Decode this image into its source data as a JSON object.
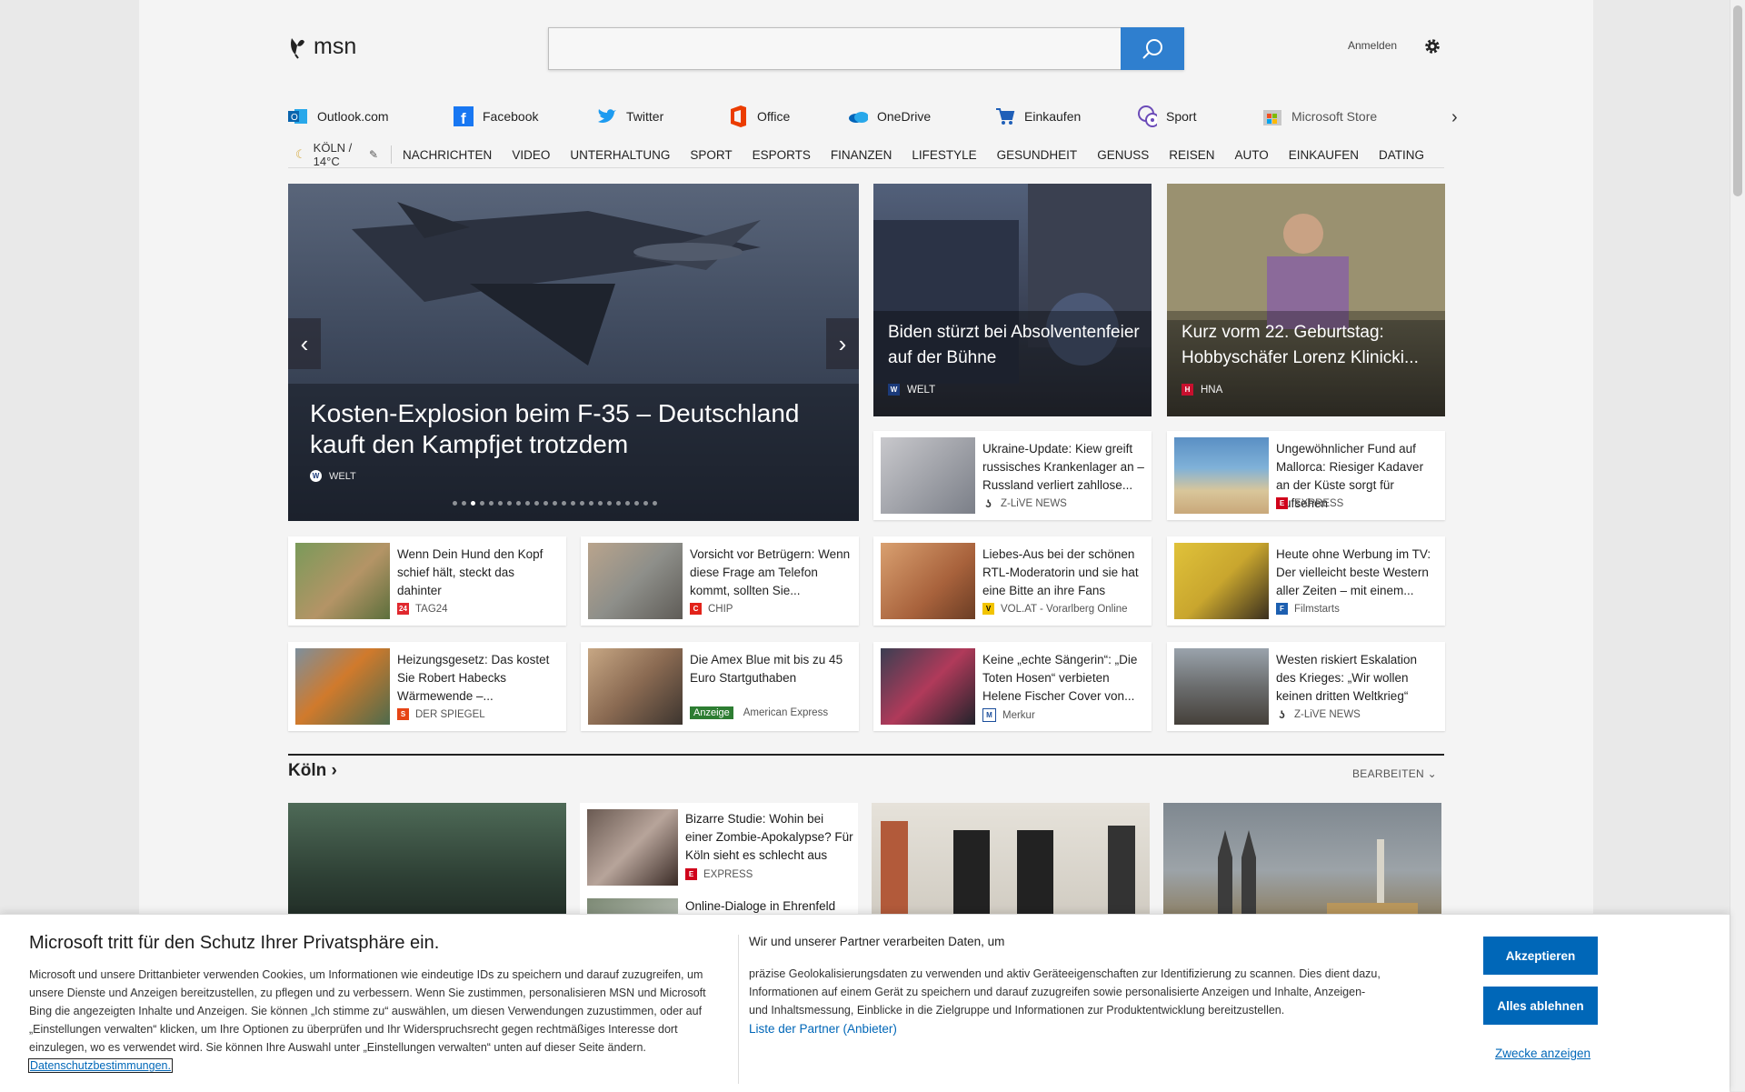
{
  "header": {
    "logo_text": "msn",
    "search_placeholder": "",
    "signin_label": "Anmelden"
  },
  "quick_links": [
    {
      "label": "Outlook.com",
      "icon": "outlook-icon"
    },
    {
      "label": "Facebook",
      "icon": "facebook-icon"
    },
    {
      "label": "Twitter",
      "icon": "twitter-icon"
    },
    {
      "label": "Office",
      "icon": "office-icon"
    },
    {
      "label": "OneDrive",
      "icon": "onedrive-icon"
    },
    {
      "label": "Einkaufen",
      "icon": "cart-icon"
    },
    {
      "label": "Sport",
      "icon": "sport-icon"
    },
    {
      "label": "Microsoft Store",
      "icon": "store-icon"
    }
  ],
  "weather": {
    "text": "KÖLN / 14°C"
  },
  "categories": [
    "NACHRICHTEN",
    "VIDEO",
    "UNTERHALTUNG",
    "SPORT",
    "ESPORTS",
    "FINANZEN",
    "LIFESTYLE",
    "GESUNDHEIT",
    "GENUSS",
    "REISEN",
    "AUTO",
    "EINKAUFEN",
    "DATING"
  ],
  "hero": {
    "title": "Kosten-Explosion beim F-35 – Deutschland kauft den Kampfjet trotzdem",
    "source": "WELT",
    "dot_count": 23,
    "active_dot": 3
  },
  "big_tiles": [
    {
      "title": "Biden stürzt bei Absolventenfeier auf der Bühne",
      "source": "WELT"
    },
    {
      "title": "Kurz vorm 22. Geburtstag: Hobbyschäfer Lorenz Klinicki...",
      "source": "HNA"
    }
  ],
  "cards": [
    {
      "title": "Ukraine-Update: Kiew greift russisches Krankenlager an – Russland verliert zahllose...",
      "source": "Z-LiVE NEWS"
    },
    {
      "title": "Ungewöhnlicher Fund auf Mallorca: Riesiger Kadaver an der Küste sorgt für Aufsehen",
      "source": "EXPRESS"
    },
    {
      "title": "Wenn Dein Hund den Kopf schief hält, steckt das dahinter",
      "source": "TAG24"
    },
    {
      "title": "Vorsicht vor Betrügern: Wenn diese Frage am Telefon kommt, sollten Sie...",
      "source": "CHIP"
    },
    {
      "title": "Liebes-Aus bei der schönen RTL-Moderatorin und sie hat eine Bitte an ihre Fans",
      "source": "VOL.AT - Vorarlberg Online"
    },
    {
      "title": "Heute ohne Werbung im TV: Der vielleicht beste Western aller Zeiten – mit einem...",
      "source": "Filmstarts"
    },
    {
      "title": "Heizungsgesetz: Das kostet Sie Robert Habecks Wärmewende –...",
      "source": "DER SPIEGEL"
    },
    {
      "title": "Die Amex Blue mit bis zu 45 Euro Startguthaben",
      "source": "American Express",
      "badge": "Anzeige"
    },
    {
      "title": "Keine „echte Sängerin“: „Die Toten Hosen“ verbieten Helene Fischer Cover von...",
      "source": "Merkur"
    },
    {
      "title": "Westen riskiert Eskalation des Krieges: „Wir wollen keinen dritten Weltkrieg“",
      "source": "Z-LiVE NEWS"
    }
  ],
  "koeln": {
    "title": "Köln",
    "edit_label": "BEARBEITEN",
    "items": [
      {
        "title": "Bizarre Studie: Wohin bei einer Zombie-Apokalypse? Für Köln sieht es schlecht aus",
        "source": "EXPRESS"
      },
      {
        "title": "Online-Dialoge in Ehrenfeld"
      }
    ]
  },
  "consent": {
    "title": "Microsoft tritt für den Schutz Ihrer Privatsphäre ein.",
    "body": "Microsoft und unsere Drittanbieter verwenden Cookies, um Informationen wie eindeutige IDs zu speichern und darauf zuzugreifen, um unsere Dienste und Anzeigen bereitzustellen, zu pflegen und zu verbessern. Wenn Sie zustimmen, personalisieren MSN und Microsoft Bing die angezeigten Inhalte und Anzeigen. Sie können „Ich stimme zu“ auswählen, um diesen Verwendungen zuzustimmen, oder auf „Einstellungen verwalten“ klicken, um Ihre Optionen zu überprüfen und Ihr Widerspruchsrecht gegen rechtmäßiges Interesse dort einzulegen, wo es verwendet wird.  Sie können Ihre Auswahl unter „Einstellungen verwalten“ unten auf dieser Seite ändern.",
    "privacy_link": "Datenschutzbestimmungen.",
    "partner_heading": "Wir und unserer Partner verarbeiten Daten, um",
    "partner_body": "präzise Geolokalisierungsdaten zu verwenden und aktiv Geräteeigenschaften zur Identifizierung zu scannen. Dies dient dazu, Informationen auf einem Gerät zu speichern und darauf zuzugreifen sowie personalisierte Anzeigen und Inhalte, Anzeigen- und Inhaltsmessung, Einblicke in die Zielgruppe und Informationen zur Produktentwicklung bereitzustellen.",
    "partner_list": "Liste der Partner (Anbieter)",
    "accept_label": "Akzeptieren",
    "reject_label": "Alles ablehnen",
    "purposes_label": "Zwecke anzeigen"
  }
}
